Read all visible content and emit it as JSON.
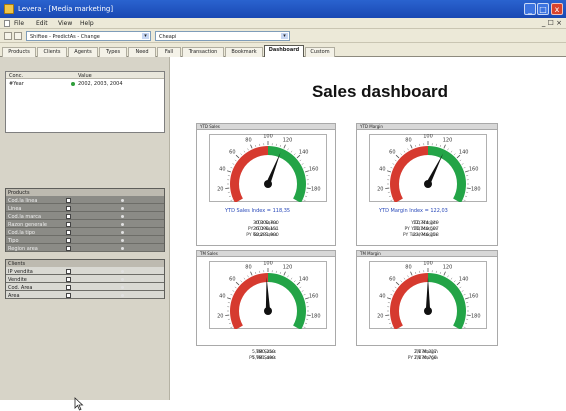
{
  "window": {
    "title": "Levera - [Media marketing]",
    "min_symbol": "_",
    "max_symbol": "□",
    "close_symbol": "x",
    "mdi_controls": "_ ☐ ×"
  },
  "menu": [
    "File",
    "Edit",
    "View",
    "Help"
  ],
  "toolbar": {
    "combo1_value": "Shiftee - PredictAs - Change",
    "combo2_value": "Cheapi"
  },
  "tabs": [
    {
      "label": "Products",
      "active": false
    },
    {
      "label": "Clients",
      "active": false
    },
    {
      "label": "Agents",
      "active": false
    },
    {
      "label": "Types",
      "active": false
    },
    {
      "label": "Need",
      "active": false
    },
    {
      "label": "Fall",
      "active": false
    },
    {
      "label": "Transaction",
      "active": false
    },
    {
      "label": "Bookmark",
      "active": false
    },
    {
      "label": "Dashboard",
      "active": true
    },
    {
      "label": "Custom",
      "active": false
    }
  ],
  "listbox": {
    "col1": "Conc.",
    "col2": "Value",
    "rows": [
      {
        "name": "#Year",
        "value": "2002, 2003, 2004"
      }
    ]
  },
  "products_box": {
    "title": "Products",
    "rows": [
      "Cod.la linea",
      "Linea",
      "Cod.la marca",
      "Razon generale",
      "Cod.la tipo",
      "Tipo",
      "Region area"
    ]
  },
  "clients_box": {
    "title": "Clients",
    "rows": [
      "IP vendita",
      "Vendite",
      "Cod. Area",
      "Area"
    ]
  },
  "dashboard_title": "Sales dashboard",
  "gauges": [
    {
      "header": "YTD Sales",
      "ticks": [
        "0",
        "20",
        "40",
        "60",
        "80",
        "100",
        "120",
        "140",
        "160",
        "180",
        "200"
      ],
      "value": 118,
      "max": 200,
      "caption": "YTD Sales Index = 118,35",
      "stats": [
        {
          "k": "YTD Sales",
          "v": "30,800,700"
        },
        {
          "k": "PY YTD Sales",
          "v": "26,096,151"
        },
        {
          "k": "PY Total Sales",
          "v": "60,281,900"
        }
      ]
    },
    {
      "header": "YTD Margin",
      "ticks": [
        "0",
        "20",
        "40",
        "60",
        "80",
        "100",
        "120",
        "140",
        "160",
        "180",
        "200"
      ],
      "value": 122,
      "max": 200,
      "caption": "YTD Margin Index = 122,03",
      "stats": [
        {
          "k": "YTD Margin",
          "v": "12,374,249"
        },
        {
          "k": "PY YTD Margin",
          "v": "10,140,507"
        },
        {
          "k": "PY Total Margin",
          "v": "23,946,258"
        }
      ]
    },
    {
      "header": "TM Sales",
      "ticks": [
        "0",
        "20",
        "40",
        "60",
        "80",
        "100",
        "120",
        "140",
        "160",
        "180",
        "200"
      ],
      "value": 98,
      "max": 200,
      "caption": "",
      "stats": [
        {
          "k": "TM Sales",
          "v": "5,880,250"
        },
        {
          "k": "PY TM Sales",
          "v": "5,981,490"
        }
      ]
    },
    {
      "header": "TM Margin",
      "ticks": [
        "0",
        "20",
        "40",
        "60",
        "80",
        "100",
        "120",
        "140",
        "160",
        "180",
        "200"
      ],
      "value": 100,
      "max": 200,
      "caption": "",
      "stats": [
        {
          "k": "TM Margin",
          "v": "2,178,327"
        },
        {
          "k": "PY TM Margin",
          "v": "2,170,766"
        }
      ]
    }
  ],
  "colors": {
    "red": "#d63a2f",
    "green": "#23a447",
    "needle": "#111111",
    "caption": "#2747b8"
  }
}
